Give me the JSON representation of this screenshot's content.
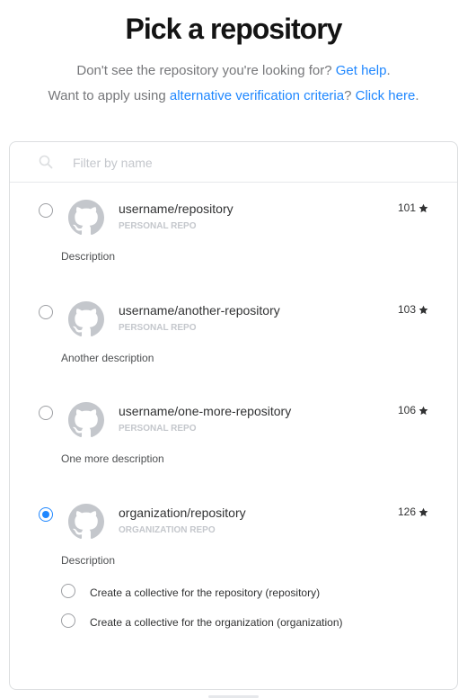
{
  "page": {
    "title": "Pick a repository",
    "line1_prefix": "Don't see the repository you're looking for? ",
    "line1_link": "Get help",
    "line1_suffix": ".",
    "line2_prefix": "Want to apply using ",
    "line2_link": "alternative verification criteria",
    "line2_mid": "? ",
    "line2_link2": "Click here",
    "line2_suffix": "."
  },
  "search": {
    "placeholder": "Filter by name",
    "icon": "search-icon"
  },
  "colors": {
    "accent": "#1f87ff",
    "text": "#313233",
    "muted": "#76777a",
    "border": "#dcdee0"
  },
  "repos": [
    {
      "name": "username/repository",
      "type": "PERSONAL REPO",
      "stars": "101",
      "description": "Description",
      "selected": false
    },
    {
      "name": "username/another-repository",
      "type": "PERSONAL REPO",
      "stars": "103",
      "description": "Another description",
      "selected": false
    },
    {
      "name": "username/one-more-repository",
      "type": "PERSONAL REPO",
      "stars": "106",
      "description": "One more description",
      "selected": false
    },
    {
      "name": "organization/repository",
      "type": "ORGANIZATION REPO",
      "stars": "126",
      "description": "Description",
      "selected": true
    }
  ],
  "options": [
    {
      "label": "Create a collective for the repository (repository)",
      "selected": false
    },
    {
      "label": "Create a collective for the organization (organization)",
      "selected": false
    }
  ]
}
